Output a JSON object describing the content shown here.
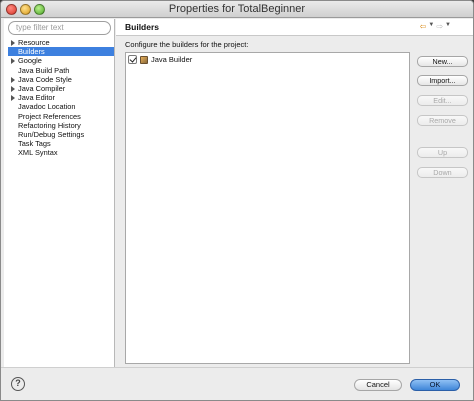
{
  "window": {
    "title": "Properties for TotalBeginner"
  },
  "filter": {
    "placeholder": "type filter text"
  },
  "tree": [
    {
      "label": "Resource",
      "expandable": true
    },
    {
      "label": "Builders",
      "selected": true
    },
    {
      "label": "Google",
      "expandable": true
    },
    {
      "label": "Java Build Path"
    },
    {
      "label": "Java Code Style",
      "expandable": true
    },
    {
      "label": "Java Compiler",
      "expandable": true
    },
    {
      "label": "Java Editor",
      "expandable": true
    },
    {
      "label": "Javadoc Location"
    },
    {
      "label": "Project References"
    },
    {
      "label": "Refactoring History"
    },
    {
      "label": "Run/Debug Settings"
    },
    {
      "label": "Task Tags"
    },
    {
      "label": "XML Syntax"
    }
  ],
  "page": {
    "title": "Builders",
    "description": "Configure the builders for the project:",
    "builders": [
      {
        "label": "Java Builder",
        "checked": true
      }
    ],
    "buttons": {
      "new": "New...",
      "import": "Import...",
      "edit": "Edit...",
      "remove": "Remove",
      "up": "Up",
      "down": "Down"
    }
  },
  "footer": {
    "help": "?",
    "cancel": "Cancel",
    "ok": "OK"
  },
  "colors": {
    "selection": "#3d80df",
    "ok_button": "#3f86d8"
  }
}
